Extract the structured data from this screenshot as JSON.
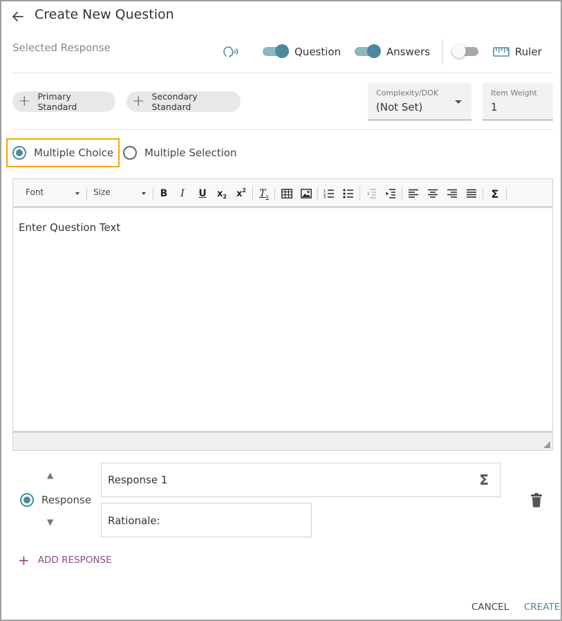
{
  "header": {
    "title": "Create New Question",
    "subtitle": "Selected Response"
  },
  "toggles": {
    "question": {
      "label": "Question",
      "on": true
    },
    "answers": {
      "label": "Answers",
      "on": true
    },
    "ruler": {
      "label": "Ruler",
      "on": false
    }
  },
  "standards": {
    "primary_label": "Primary Standard",
    "secondary_label": "Secondary Standard"
  },
  "complexity": {
    "label": "Complexity/DOK",
    "value": "(Not Set)"
  },
  "item_weight": {
    "label": "Item Weight",
    "value": "1"
  },
  "question_type": {
    "options": [
      {
        "label": "Multiple Choice",
        "selected": true
      },
      {
        "label": "Multiple Selection",
        "selected": false
      }
    ]
  },
  "editor": {
    "font_label": "Font",
    "size_label": "Size",
    "placeholder": "Enter Question Text"
  },
  "response": {
    "label": "Response",
    "text": "Response 1",
    "rationale": "Rationale:"
  },
  "actions": {
    "add_response": "ADD RESPONSE",
    "cancel": "CANCEL",
    "create": "CREATE"
  },
  "colors": {
    "accent": "#4a8a9a",
    "highlight": "#f0a800",
    "add_response": "#8a4b82"
  }
}
